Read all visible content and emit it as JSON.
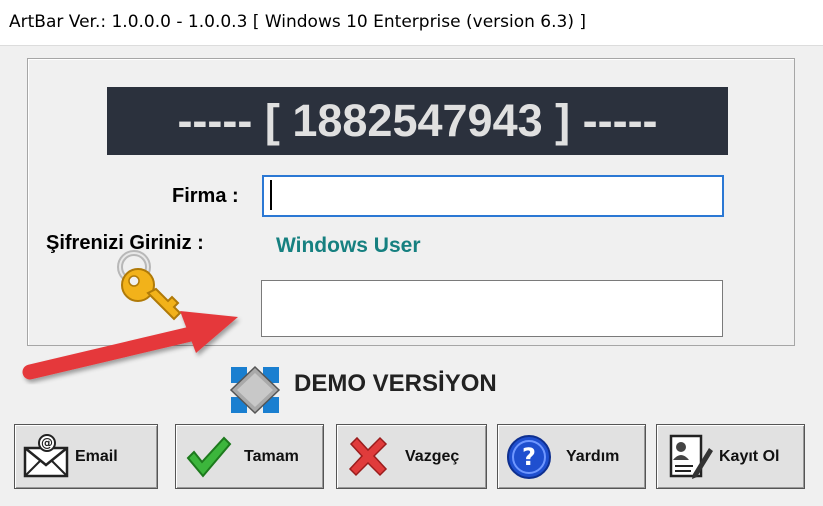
{
  "window": {
    "title": "ArtBar  Ver.: 1.0.0.0 - 1.0.0.3  [ Windows 10 Enterprise (version 6.3) ]"
  },
  "serial": {
    "text": "----- [ 1882547943 ] -----"
  },
  "form": {
    "firma_label": "Firma :",
    "firma_value": "",
    "password_label": "Şifrenizi Giriniz :",
    "user_name": "Windows User",
    "password_value": ""
  },
  "demo": {
    "label": "DEMO VERSİYON"
  },
  "buttons": {
    "email": "Email",
    "ok": "Tamam",
    "cancel": "Vazgeç",
    "help": "Yardım",
    "register": "Kayıt Ol"
  },
  "icons": {
    "key": "key-icon",
    "arrow": "red-arrow-annotation",
    "demo": "diamond-icon",
    "email": "envelope-icon",
    "ok": "checkmark-icon",
    "cancel": "red-x-icon",
    "help": "question-icon",
    "register": "document-user-icon"
  },
  "colors": {
    "serial_bg": "#2b313d",
    "serial_text": "#e0e0e0",
    "user_text": "#168080",
    "focus_border": "#2b78d4",
    "arrow": "#e5393b"
  }
}
